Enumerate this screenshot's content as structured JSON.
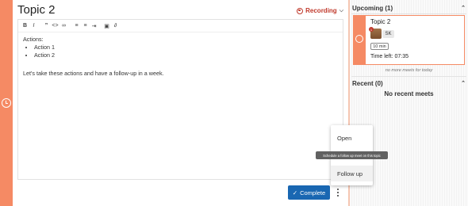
{
  "meeting": {
    "title": "Topic 2",
    "recording_label": "Recording"
  },
  "editor": {
    "toolbar_icons": [
      "bold-icon",
      "italic-icon",
      "quote-icon",
      "code-icon",
      "link-icon",
      "bulleted-list-icon",
      "numbered-list-icon",
      "indent-icon",
      "image-icon",
      "attachment-icon"
    ],
    "heading": "Actions:",
    "list_items": [
      "Action 1",
      "Action 2"
    ],
    "paragraph": "Let's take these actions and have a follow-up in a week."
  },
  "actions": {
    "complete_label": "Complete",
    "menu_items": [
      "Open",
      "Follow up"
    ],
    "tooltip": "Schedule a follow up meet on this topic"
  },
  "sidebar": {
    "upcoming_title": "Upcoming (1)",
    "card": {
      "title": "Topic 2",
      "avatar_initials": "SK",
      "badge": "1",
      "duration": "10 min",
      "time_left": "Time left: 07:35"
    },
    "no_more_text": "no more meets for today",
    "recent_title": "Recent (0)",
    "no_recent_text": "No recent meets"
  },
  "colors": {
    "accent_orange": "#f58a64",
    "primary_blue": "#1967b2",
    "recording_red": "#c0392b"
  }
}
